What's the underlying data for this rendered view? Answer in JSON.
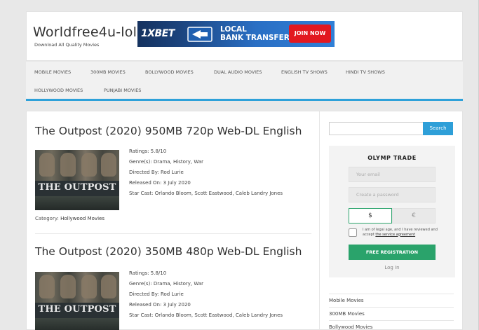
{
  "site": {
    "title": "Worldfree4u-lol",
    "tagline": "Download All Quality Movies"
  },
  "banner": {
    "brand": "1XBET",
    "line1": "LOCAL",
    "line2": "BANK TRANSFER",
    "cta": "JOIN NOW",
    "icon": "bank-transfer-icon"
  },
  "nav": {
    "items": [
      {
        "label": "MOBILE MOVIES"
      },
      {
        "label": "300MB MOVIES"
      },
      {
        "label": "BOLLYWOOD MOVIES"
      },
      {
        "label": "DUAL AUDIO MOVIES"
      },
      {
        "label": "ENGLISH TV SHOWS"
      },
      {
        "label": "HINDI TV SHOWS"
      },
      {
        "label": "HOLLYWOOD MOVIES"
      },
      {
        "label": "PUNJABI MOVIES"
      }
    ]
  },
  "posts": [
    {
      "title": "The Outpost (2020) 950MB 720p Web-DL English",
      "poster_title": "THE OUTPOST",
      "ratings": "Ratings: 5.8/10",
      "genres": "Genre(s): Drama, History, War",
      "director": "Directed By: Rod Lurie",
      "released": "Released On: 3 July 2020",
      "cast": "Star Cast: Orlando Bloom, Scott Eastwood, Caleb Landry Jones",
      "category_label": "Category:",
      "category": "Hollywood Movies"
    },
    {
      "title": "The Outpost (2020) 350MB 480p Web-DL English",
      "poster_title": "THE OUTPOST",
      "ratings": "Ratings: 5.8/10",
      "genres": "Genre(s): Drama, History, War",
      "director": "Directed By: Rod Lurie",
      "released": "Released On: 3 July 2020",
      "cast": "Star Cast: Orlando Bloom, Scott Eastwood, Caleb Landry Jones"
    }
  ],
  "sidebar": {
    "search_placeholder": "",
    "search_button": "Search",
    "ad": {
      "logo": "OLYMP TRADE",
      "email_placeholder": "Your email",
      "password_placeholder": "Create a password",
      "currency_usd": "$",
      "currency_eur": "€",
      "agree_text": "I am of legal age, and I have reviewed and accept",
      "agree_link": "the service agreement",
      "register_button": "FREE REGISTRATION",
      "login_link": "Log In"
    },
    "links": [
      {
        "label": "Mobile Movies"
      },
      {
        "label": "300MB Movies"
      },
      {
        "label": "Bollywood Movies"
      }
    ]
  },
  "colors": {
    "accent": "#2ea1d9",
    "register_green": "#2aa36b",
    "banner_red": "#e21820"
  }
}
